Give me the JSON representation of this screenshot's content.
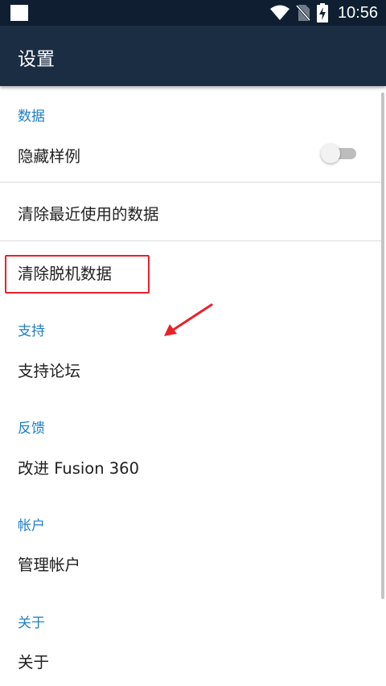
{
  "status_bar": {
    "time": "10:56",
    "icons": [
      "notification-square-icon",
      "wifi-icon",
      "no-sim-icon",
      "battery-charging-icon"
    ]
  },
  "app_bar": {
    "title": "设置"
  },
  "settings": {
    "sections": [
      {
        "header": "数据",
        "items": [
          {
            "label": "隐藏样例",
            "toggle_on": false
          },
          {
            "label": "清除最近使用的数据"
          },
          {
            "label": "清除脱机数据"
          }
        ]
      },
      {
        "header": "支持",
        "items": [
          {
            "label": "支持论坛"
          }
        ]
      },
      {
        "header": "反馈",
        "items": [
          {
            "label": "改进 Fusion 360"
          }
        ]
      },
      {
        "header": "帐户",
        "items": [
          {
            "label": "管理帐户"
          }
        ]
      },
      {
        "header": "关于",
        "items": [
          {
            "label": "关于"
          }
        ]
      }
    ]
  },
  "colors": {
    "status_bar": "#0f1f31",
    "app_bar": "#1b2d43",
    "section_header": "#1f7ec4",
    "annotation": "#e8222a"
  }
}
